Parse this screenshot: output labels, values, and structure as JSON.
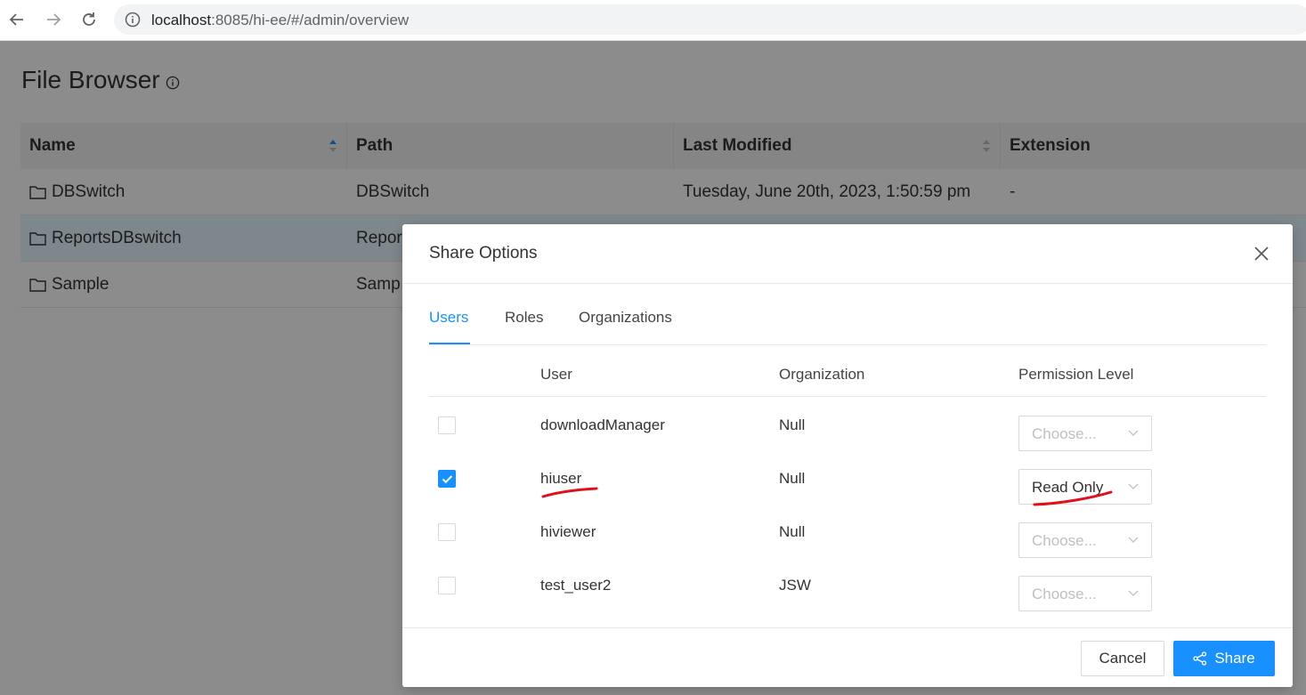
{
  "browser": {
    "url_host": "localhost",
    "url_rest": ":8085/hi-ee/#/admin/overview"
  },
  "page": {
    "title": "File Browser"
  },
  "file_table": {
    "columns": [
      "Name",
      "Path",
      "Last Modified",
      "Extension"
    ],
    "rows": [
      {
        "name": "DBSwitch",
        "path": "DBSwitch",
        "modified": "Tuesday, June 20th, 2023, 1:50:59 pm",
        "ext": "-"
      },
      {
        "name": "ReportsDBswitch",
        "path": "Repor",
        "modified": "",
        "ext": ""
      },
      {
        "name": "Sample",
        "path": "Samp",
        "modified": "",
        "ext": ""
      }
    ]
  },
  "modal": {
    "title": "Share Options",
    "tabs": [
      "Users",
      "Roles",
      "Organizations"
    ],
    "active_tab": "Users",
    "columns": {
      "user": "User",
      "org": "Organization",
      "permission": "Permission Level"
    },
    "rows": [
      {
        "user": "downloadManager",
        "org": "Null",
        "permission": "Choose...",
        "checked": false
      },
      {
        "user": "hiuser",
        "org": "Null",
        "permission": "Read Only",
        "checked": true
      },
      {
        "user": "hiviewer",
        "org": "Null",
        "permission": "Choose...",
        "checked": false
      },
      {
        "user": "test_user2",
        "org": "JSW",
        "permission": "Choose...",
        "checked": false
      }
    ],
    "cancel_label": "Cancel",
    "share_label": "Share"
  },
  "colors": {
    "accent": "#1890ff",
    "annotation": "#e0101a"
  }
}
